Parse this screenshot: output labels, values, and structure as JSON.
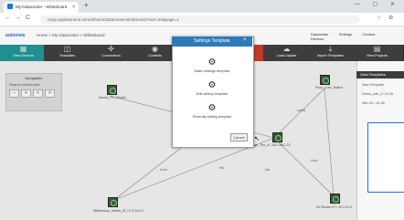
{
  "browser": {
    "tab_title": "My Datacenter - Whiteboard",
    "tab_close": "×",
    "new_tab": "+",
    "window_controls": "— ▢ ✕",
    "nav_back": "←",
    "nav_forward": "→",
    "nav_reload": "C",
    "url": "myiq.capitaloneon.io/rest/home/datacenter/whiteboard?sort=24&page=1",
    "right_icons": [
      "☆",
      "⚙"
    ]
  },
  "app": {
    "logo": "autoview",
    "breadcrumb": "Home > My Datacenter > Whiteboard",
    "header_controls": [
      "Datacenter",
      "Settings",
      "Content",
      "Devices"
    ],
    "toolbar": [
      {
        "label": "View Devices",
        "icon": "▦",
        "style": "teal"
      },
      {
        "label": "Templates",
        "icon": "◫",
        "style": "dark"
      },
      {
        "label": "Connections",
        "icon": "✣",
        "style": "dark"
      },
      {
        "label": "Contexts",
        "icon": "◉",
        "style": "dark"
      },
      {
        "label": "",
        "icon": "",
        "style": "dark"
      },
      {
        "label": "Monitor Router",
        "icon": "✎",
        "style": "red"
      },
      {
        "label": "Load Update",
        "icon": "☁",
        "style": "dark"
      },
      {
        "label": "Import Templates",
        "icon": "⤓",
        "style": "dark"
      },
      {
        "label": "View Projects",
        "icon": "▤",
        "style": "dark"
      }
    ]
  },
  "panel": {
    "title": "Navigation",
    "subtitle": "Search whiteboard",
    "buttons": [
      "−",
      "+",
      "<",
      ">"
    ]
  },
  "nodes": [
    {
      "label": "Device_PC_Router"
    },
    {
      "label": "Floor_Core_Switch"
    },
    {
      "label": "Storage_Tier_A / 192.168.1.23"
    },
    {
      "label": "Warehouse_Switch_01 / 172.16.4.7"
    },
    {
      "label": "NY-Router-07 / 10.1.5.12"
    }
  ],
  "link_labels": [
    "uplink",
    "uplink",
    "trunk",
    "trunk",
    "link",
    "link"
  ],
  "sidebar": {
    "header": "View Templates",
    "items": [
      "New Template",
      "Demo_site_2/ 10.26",
      "Site-04 / 12.48"
    ]
  },
  "modal": {
    "title": "Settings Template",
    "close": "×",
    "options": [
      {
        "icon": "gear-icon",
        "glyph": "⚙",
        "label": "Make settings template"
      },
      {
        "icon": "gear-icon",
        "glyph": "⚙",
        "label": "Edit setting template"
      },
      {
        "icon": "gear-icon",
        "glyph": "⚙",
        "label": "Recently setting template"
      }
    ],
    "cancel": "Cancel"
  },
  "colors": {
    "modal_header": "#2e7ab8",
    "toolbar_dark": "#3d3d3d",
    "toolbar_red": "#c0392b",
    "toolbar_teal": "#1f8f8f",
    "canvas": "#e6e6e6"
  }
}
